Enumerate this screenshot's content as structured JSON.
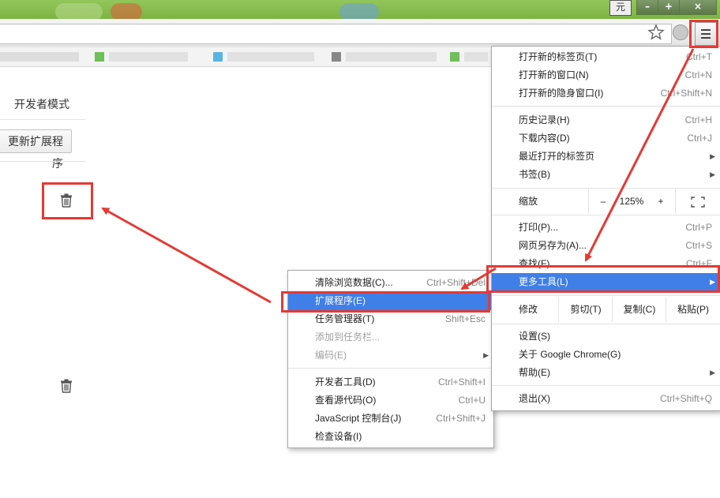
{
  "window": {
    "user_badge": "元",
    "minimize": "–",
    "maximize": "+",
    "close": "×"
  },
  "page": {
    "developer_mode_label": "开发者模式",
    "update_extensions_button": "更新扩展程序"
  },
  "main_menu": {
    "items_group1": [
      {
        "label": "打开新的标签页(T)",
        "shortcut": "Ctrl+T"
      },
      {
        "label": "打开新的窗口(N)",
        "shortcut": "Ctrl+N"
      },
      {
        "label": "打开新的隐身窗口(I)",
        "shortcut": "Ctrl+Shift+N"
      }
    ],
    "items_group2": [
      {
        "label": "历史记录(H)",
        "shortcut": "Ctrl+H"
      },
      {
        "label": "下载内容(D)",
        "shortcut": "Ctrl+J"
      },
      {
        "label": "最近打开的标签页",
        "shortcut": ""
      },
      {
        "label": "书签(B)",
        "shortcut": ""
      }
    ],
    "zoom": {
      "label": "缩放",
      "minus": "–",
      "value": "125%",
      "plus": "+"
    },
    "items_group3": [
      {
        "label": "打印(P)...",
        "shortcut": "Ctrl+P"
      },
      {
        "label": "网页另存为(A)...",
        "shortcut": "Ctrl+S"
      },
      {
        "label": "查找(F)...",
        "shortcut": "Ctrl+F"
      },
      {
        "label": "更多工具(L)",
        "shortcut": ""
      }
    ],
    "edit": {
      "label": "修改",
      "cut": "剪切(T)",
      "copy": "复制(C)",
      "paste": "粘贴(P)"
    },
    "items_group4": [
      {
        "label": "设置(S)",
        "shortcut": ""
      },
      {
        "label": "关于 Google Chrome(G)",
        "shortcut": ""
      },
      {
        "label": "帮助(E)",
        "shortcut": ""
      }
    ],
    "exit": {
      "label": "退出(X)",
      "shortcut": "Ctrl+Shift+Q"
    }
  },
  "more_tools_menu": {
    "items_group1": [
      {
        "label": "清除浏览数据(C)...",
        "shortcut": "Ctrl+Shift+Del"
      },
      {
        "label": "扩展程序(E)",
        "shortcut": ""
      },
      {
        "label": "任务管理器(T)",
        "shortcut": "Shift+Esc"
      },
      {
        "label": "添加到任务栏...",
        "shortcut": ""
      },
      {
        "label": "编码(E)",
        "shortcut": ""
      }
    ],
    "items_group2": [
      {
        "label": "开发者工具(D)",
        "shortcut": "Ctrl+Shift+I"
      },
      {
        "label": "查看源代码(O)",
        "shortcut": "Ctrl+U"
      },
      {
        "label": "JavaScript 控制台(J)",
        "shortcut": "Ctrl+Shift+J"
      },
      {
        "label": "检查设备(I)",
        "shortcut": ""
      }
    ]
  },
  "colors": {
    "highlight": "#3f7fe8",
    "annotation_red": "#e53935",
    "titlebar_green": "#7db343"
  }
}
